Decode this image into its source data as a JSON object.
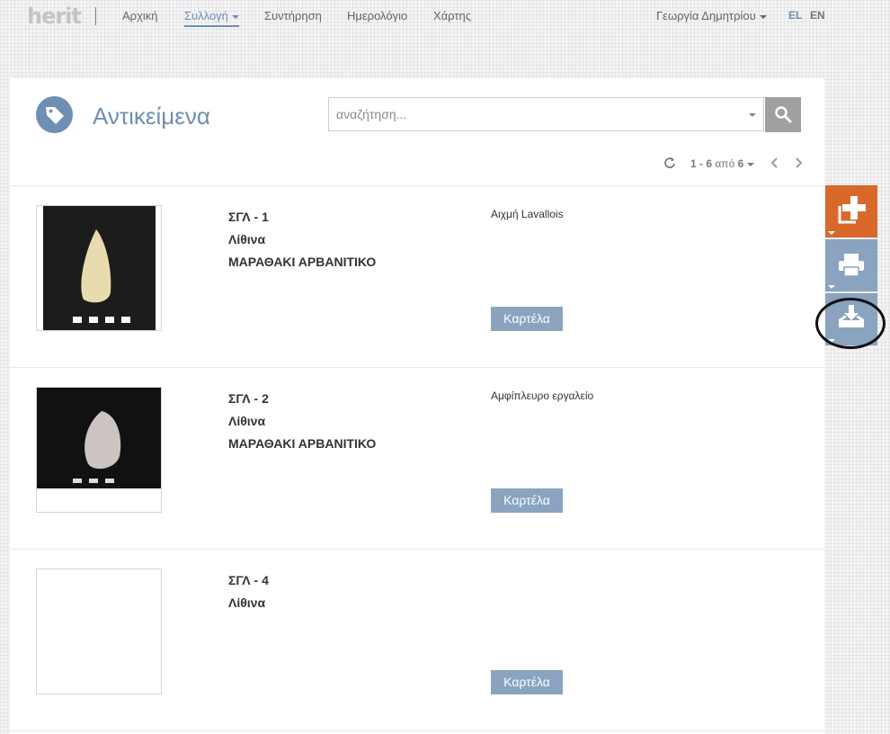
{
  "nav": {
    "logo": "herit",
    "items": [
      {
        "label": "Αρχική",
        "active": false
      },
      {
        "label": "Συλλογή",
        "active": true,
        "dropdown": true
      },
      {
        "label": "Συντήρηση",
        "active": false
      },
      {
        "label": "Ημερολόγιο",
        "active": false
      },
      {
        "label": "Χάρτης",
        "active": false
      }
    ],
    "user": "Γεωργία Δημητρίου",
    "lang_el": "EL",
    "lang_en": "EN"
  },
  "header": {
    "title": "Αντικείμενα",
    "icon": "tag-icon"
  },
  "search": {
    "placeholder": "αναζήτηση...",
    "value": ""
  },
  "pager": {
    "range": "1 - 6",
    "of_label": "από",
    "total": "6"
  },
  "items": [
    {
      "code": "ΣΓΛ - 1",
      "category": "Λίθινα",
      "site": "ΜΑΡΑΘΑΚΙ ΑΡΒΑΝΙΤΙΚΟ",
      "description": "Αιχμή Lavallois",
      "button": "Καρτέλα",
      "image": "flint-point-photo"
    },
    {
      "code": "ΣΓΛ - 2",
      "category": "Λίθινα",
      "site": "ΜΑΡΑΘΑΚΙ ΑΡΒΑΝΙΤΙΚΟ",
      "description": "Αμφίπλευρο εργαλείο",
      "button": "Καρτέλα",
      "image": "biface-tool-photo"
    },
    {
      "code": "ΣΓΛ - 4",
      "category": "Λίθινα",
      "site": "",
      "description": "",
      "button": "Καρτέλα",
      "image": ""
    }
  ],
  "side_actions": [
    {
      "name": "add",
      "icon": "plus-icon",
      "color": "#d9692b"
    },
    {
      "name": "print",
      "icon": "printer-icon",
      "color": "#8aa4c0"
    },
    {
      "name": "download",
      "icon": "download-tray-icon",
      "color": "#8aa4c0"
    }
  ],
  "colors": {
    "accent": "#6f8eb3",
    "orange": "#d9692b",
    "button": "#8aa4c0"
  }
}
